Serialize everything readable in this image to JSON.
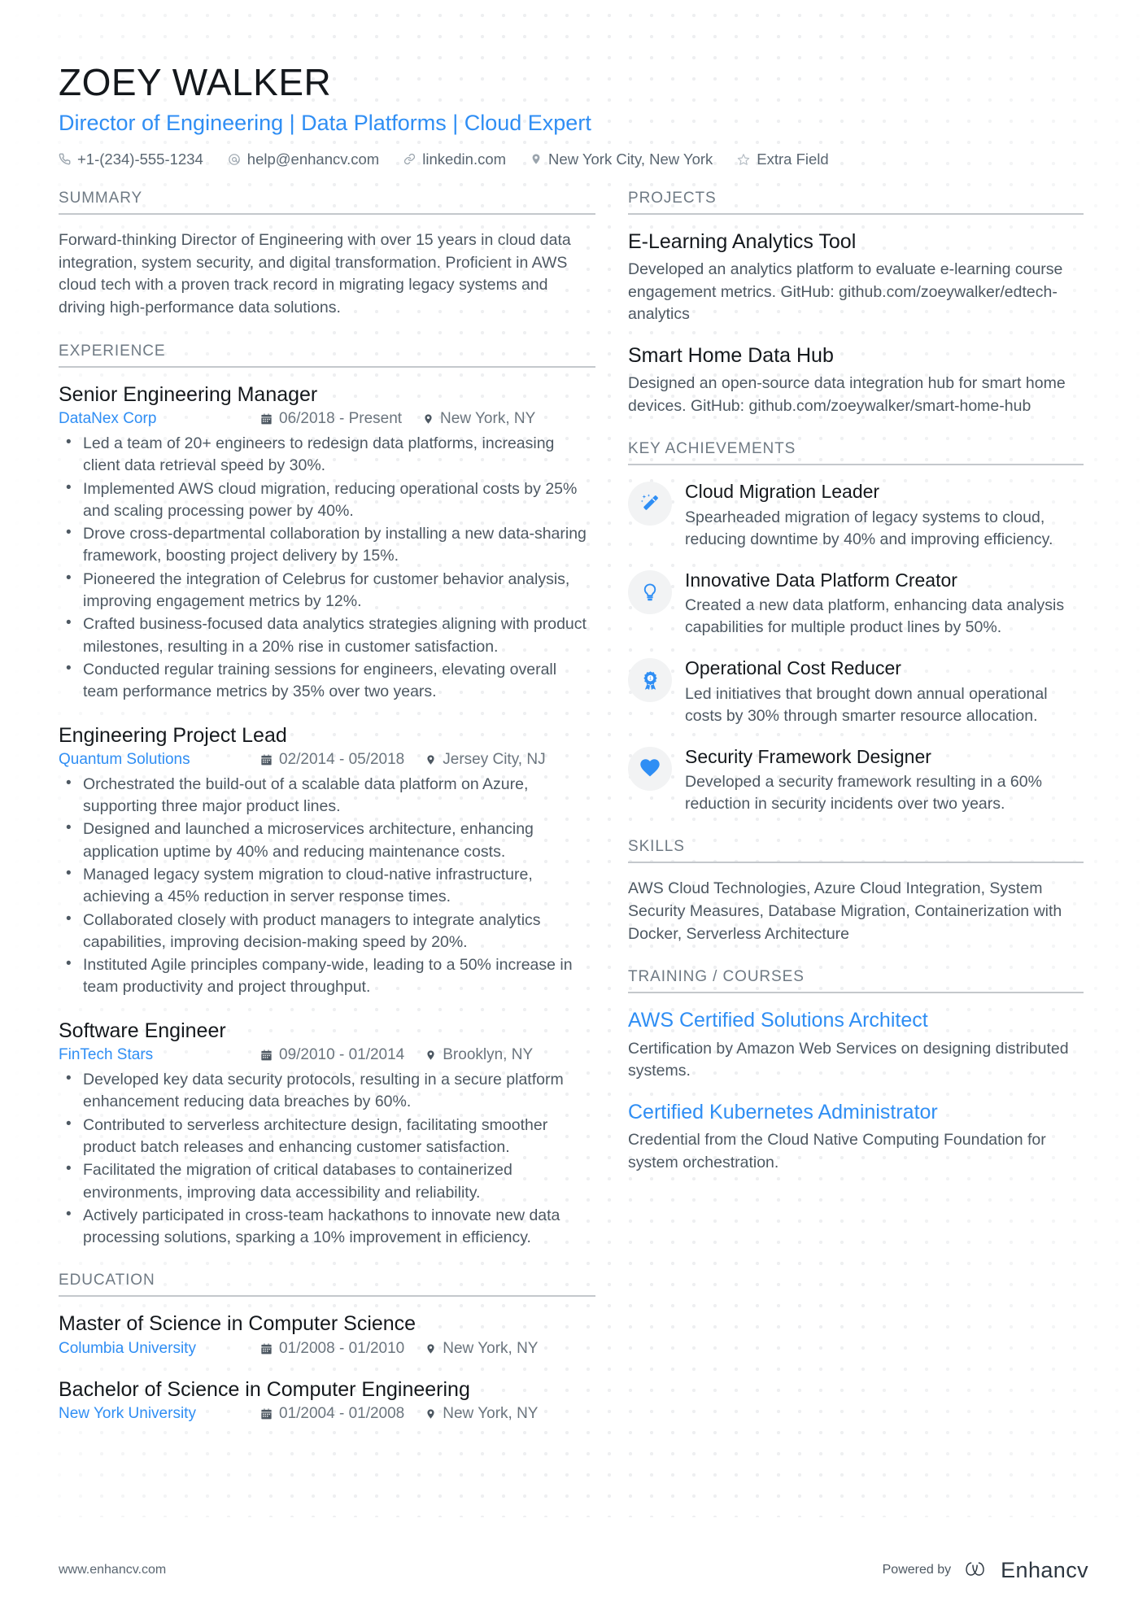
{
  "header": {
    "name": "ZOEY WALKER",
    "headline": "Director of Engineering | Data Platforms | Cloud Expert",
    "contacts": [
      {
        "icon": "phone-icon",
        "text": "+1-(234)-555-1234"
      },
      {
        "icon": "email-icon",
        "text": "help@enhancv.com"
      },
      {
        "icon": "link-icon",
        "text": "linkedin.com"
      },
      {
        "icon": "location-pin-icon",
        "text": "New York City, New York"
      },
      {
        "icon": "star-icon",
        "text": "Extra Field"
      }
    ]
  },
  "left": {
    "summary": {
      "heading": "SUMMARY",
      "text": "Forward-thinking Director of Engineering with over 15 years in cloud data integration, system security, and digital transformation. Proficient in AWS cloud tech with a proven track record in migrating legacy systems and driving high-performance data solutions."
    },
    "experience": {
      "heading": "EXPERIENCE",
      "entries": [
        {
          "title": "Senior Engineering Manager",
          "org": "DataNex Corp",
          "dates": "06/2018 - Present",
          "location": "New York, NY",
          "bullets": [
            "Led a team of 20+ engineers to redesign data platforms, increasing client data retrieval speed by 30%.",
            "Implemented AWS cloud migration, reducing operational costs by 25% and scaling processing power by 40%.",
            "Drove cross-departmental collaboration by installing a new data-sharing framework, boosting project delivery by 15%.",
            "Pioneered the integration of Celebrus for customer behavior analysis, improving engagement metrics by 12%.",
            "Crafted business-focused data analytics strategies aligning with product milestones, resulting in a 20% rise in customer satisfaction.",
            "Conducted regular training sessions for engineers, elevating overall team performance metrics by 35% over two years."
          ]
        },
        {
          "title": "Engineering Project Lead",
          "org": "Quantum Solutions",
          "dates": "02/2014 - 05/2018",
          "location": "Jersey City, NJ",
          "bullets": [
            "Orchestrated the build-out of a scalable data platform on Azure, supporting three major product lines.",
            "Designed and launched a microservices architecture, enhancing application uptime by 40% and reducing maintenance costs.",
            "Managed legacy system migration to cloud-native infrastructure, achieving a 45% reduction in server response times.",
            "Collaborated closely with product managers to integrate analytics capabilities, improving decision-making speed by 20%.",
            "Instituted Agile principles company-wide, leading to a 50% increase in team productivity and project throughput."
          ]
        },
        {
          "title": "Software Engineer",
          "org": "FinTech Stars",
          "dates": "09/2010 - 01/2014",
          "location": "Brooklyn, NY",
          "bullets": [
            "Developed key data security protocols, resulting in a secure platform enhancement reducing data breaches by 60%.",
            "Contributed to serverless architecture design, facilitating smoother product batch releases and enhancing customer satisfaction.",
            "Facilitated the migration of critical databases to containerized environments, improving data accessibility and reliability.",
            "Actively participated in cross-team hackathons to innovate new data processing solutions, sparking a 10% improvement in efficiency."
          ]
        }
      ]
    },
    "education": {
      "heading": "EDUCATION",
      "entries": [
        {
          "title": "Master of Science in Computer Science",
          "org": "Columbia University",
          "dates": "01/2008 - 01/2010",
          "location": "New York, NY"
        },
        {
          "title": "Bachelor of Science in Computer Engineering",
          "org": "New York University",
          "dates": "01/2004 - 01/2008",
          "location": "New York, NY"
        }
      ]
    }
  },
  "right": {
    "projects": {
      "heading": "PROJECTS",
      "items": [
        {
          "title": "E-Learning Analytics Tool",
          "desc": "Developed an analytics platform to evaluate e-learning course engagement metrics. GitHub: github.com/zoeywalker/edtech-analytics"
        },
        {
          "title": "Smart Home Data Hub",
          "desc": "Designed an open-source data integration hub for smart home devices. GitHub: github.com/zoeywalker/smart-home-hub"
        }
      ]
    },
    "achievements": {
      "heading": "KEY ACHIEVEMENTS",
      "items": [
        {
          "icon": "magic-wand-icon",
          "title": "Cloud Migration Leader",
          "desc": "Spearheaded migration of legacy systems to cloud, reducing downtime by 40% and improving efficiency."
        },
        {
          "icon": "lightbulb-icon",
          "title": "Innovative Data Platform Creator",
          "desc": "Created a new data platform, enhancing data analysis capabilities for multiple product lines by 50%."
        },
        {
          "icon": "award-ribbon-icon",
          "title": "Operational Cost Reducer",
          "desc": "Led initiatives that brought down annual operational costs by 30% through smarter resource allocation."
        },
        {
          "icon": "heart-icon",
          "title": "Security Framework Designer",
          "desc": "Developed a security framework resulting in a 60% reduction in security incidents over two years."
        }
      ]
    },
    "skills": {
      "heading": "SKILLS",
      "text": "AWS Cloud Technologies, Azure Cloud Integration, System Security Measures, Database Migration, Containerization with Docker, Serverless Architecture"
    },
    "training": {
      "heading": "TRAINING / COURSES",
      "items": [
        {
          "title": "AWS Certified Solutions Architect",
          "desc": "Certification by Amazon Web Services on designing distributed systems."
        },
        {
          "title": "Certified Kubernetes Administrator",
          "desc": "Credential from the Cloud Native Computing Foundation for system orchestration."
        }
      ]
    }
  },
  "footer": {
    "site": "www.enhancv.com",
    "powered_by": "Powered by",
    "brand": "Enhancv"
  },
  "colors": {
    "accent": "#2f8ef4",
    "text": "#4d5862",
    "heading": "#14181c",
    "rule": "#c4c8cc",
    "icon_bg": "#f2f3f4"
  }
}
